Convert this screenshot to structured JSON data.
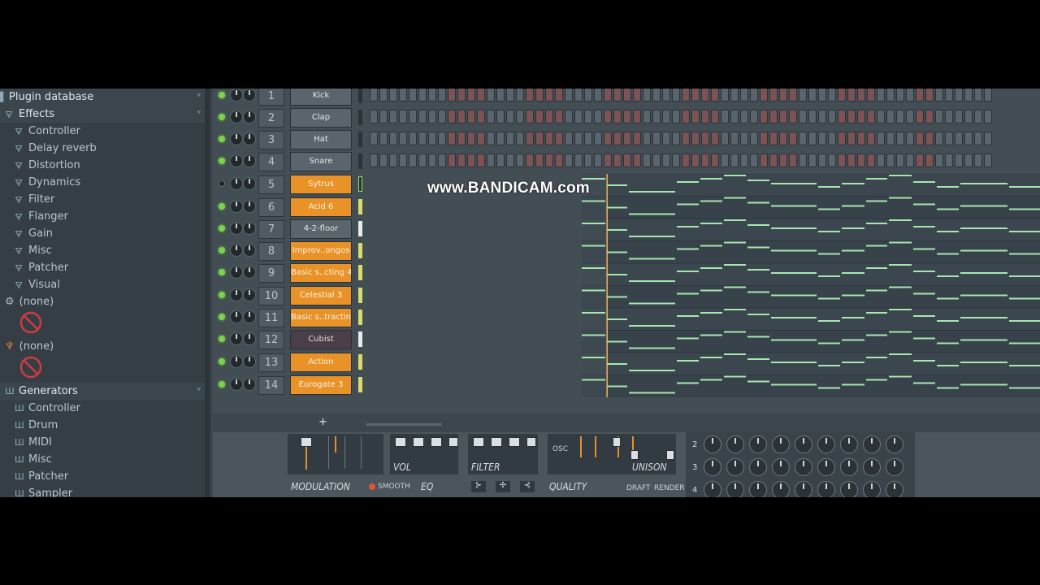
{
  "watermark": "www.BANDICAM.com",
  "browser": {
    "title": "Plugin database",
    "effects": {
      "label": "Effects",
      "items": [
        "Controller",
        "Delay reverb",
        "Distortion",
        "Dynamics",
        "Filter",
        "Flanger",
        "Gain",
        "Misc",
        "Patcher",
        "Visual"
      ]
    },
    "slot1": {
      "label": "(none)",
      "icon": "gear-icon"
    },
    "slot2": {
      "label": "(none)",
      "icon": "plug-icon"
    },
    "generators": {
      "label": "Generators",
      "items": [
        "Controller",
        "Drum",
        "MIDI",
        "Misc",
        "Patcher",
        "Sampler"
      ]
    }
  },
  "channels": [
    {
      "num": "1",
      "name": "Kick",
      "style": "grey",
      "led": "on"
    },
    {
      "num": "2",
      "name": "Clap",
      "style": "grey",
      "led": "on"
    },
    {
      "num": "3",
      "name": "Hat",
      "style": "grey",
      "led": "on"
    },
    {
      "num": "4",
      "name": "Snare",
      "style": "grey",
      "led": "on"
    },
    {
      "num": "5",
      "name": "Sytrus",
      "style": "orange",
      "led": "off"
    },
    {
      "num": "6",
      "name": "Acid 6",
      "style": "orange",
      "led": "on"
    },
    {
      "num": "7",
      "name": "4-2-floor",
      "style": "grey",
      "led": "on"
    },
    {
      "num": "8",
      "name": "Improv..ongos",
      "style": "orange",
      "led": "on"
    },
    {
      "num": "9",
      "name": "Basic s..cting 4",
      "style": "orange",
      "led": "on"
    },
    {
      "num": "10",
      "name": "Celestial 3",
      "style": "orange",
      "led": "on"
    },
    {
      "num": "11",
      "name": "Basic s..tracting",
      "style": "orange",
      "led": "on"
    },
    {
      "num": "12",
      "name": "Cubist",
      "style": "dark",
      "led": "on"
    },
    {
      "num": "13",
      "name": "Action",
      "style": "orange",
      "led": "on"
    },
    {
      "num": "14",
      "name": "Eurogate 3",
      "style": "orange",
      "led": "on"
    }
  ],
  "rack": {
    "add_label": "+"
  },
  "synth": {
    "vol_label": "VOL",
    "filter_label": "FILTER",
    "osc_label": "OSC",
    "unison_label": "UNISON",
    "modulation_label": "MODULATION",
    "smooth_label": "SMOOTH",
    "eq_label": "EQ",
    "quality_label": "QUALITY",
    "draft_label": "DRAFT",
    "render_label": "RENDER",
    "matrix_rows": [
      "2",
      "3",
      "4"
    ]
  },
  "colors": {
    "accent_orange": "#e89228",
    "led_green": "#7ad44a",
    "note_green": "#a6e8b0"
  }
}
